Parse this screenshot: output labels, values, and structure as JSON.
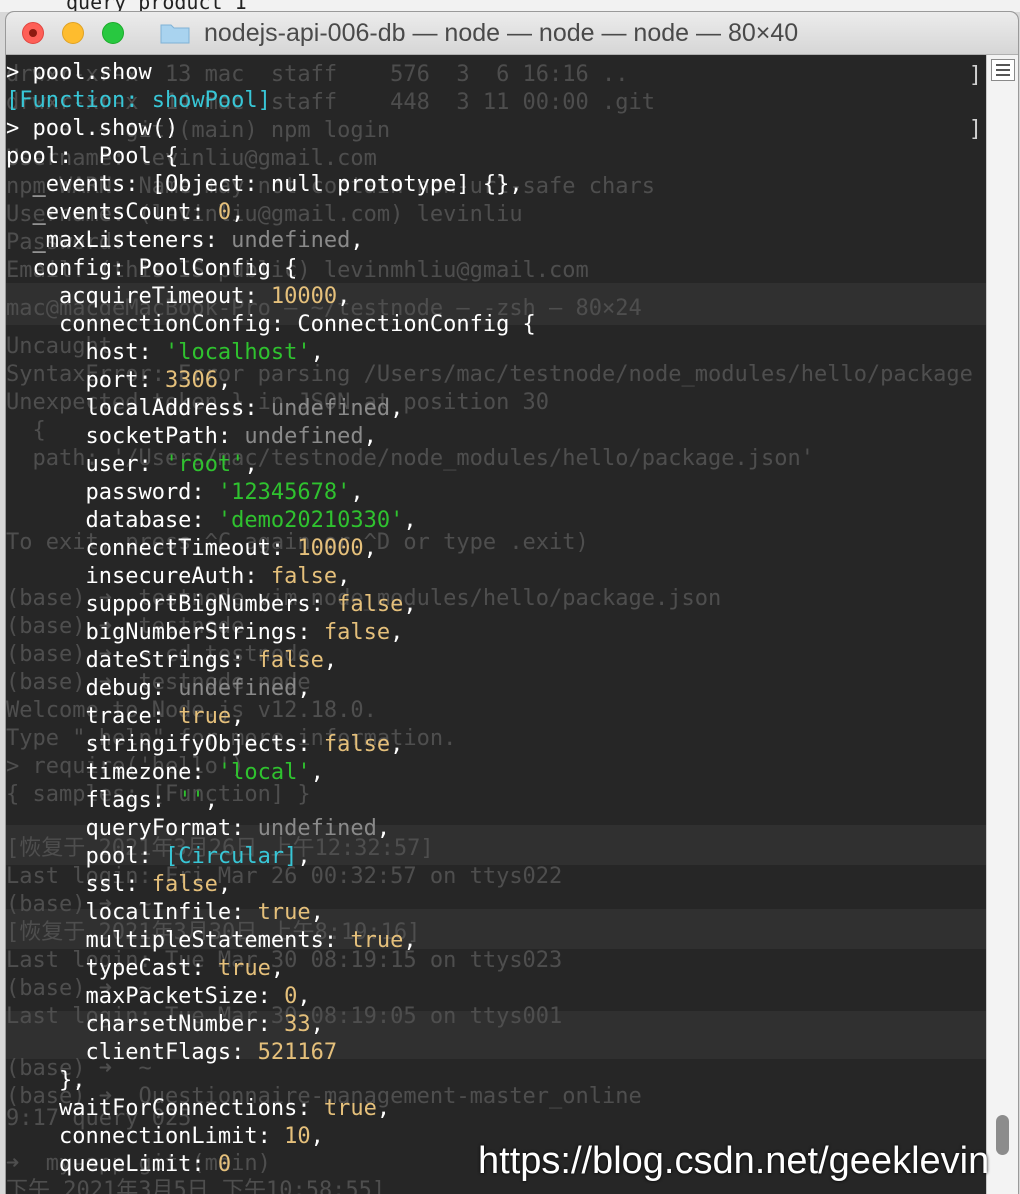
{
  "window": {
    "title": "nodejs-api-006-db — node — node — node — 80×40"
  },
  "top_bleed_text": "query product 1",
  "background_text": [
    "drwxr-xr-x  13 mac  staff    576  3  6 16:16 ..",
    "drwxr-xr-x  14 mac  staff    448  3 11 00:00 .git",
    "    ➜  ~ git:(main) npm login",
    "Username: levinliu@gmail.com",
    "npm WARN  Name may not contain non-url-safe chars",
    "Username: (levinliu@gmail.com) levinliu",
    "Password:",
    "Email: (this IS public) levinmhliu@gmail.com",
    "mac@macdeMacBook-Pro — ~/testnode — -zsh — 80×24",
    "Uncaught",
    "SyntaxError: Error parsing /Users/mac/testnode/node_modules/hello/package",
    "Unexpected token } in JSON at position 30",
    "  {",
    "  path: '/Users/mac/testnode/node_modules/hello/package.json'",
    "To exit, press ^C again or ^D or type .exit)",
    "(base) ➜  testnode vim node_modules/hello/package.json",
    "(base) ➜  testnode",
    "(base) ➜  ~ cd testnode",
    "(base) ➜  testnode node",
    "Welcome to Node.js v12.18.0.",
    "Type \".help\" for more information.",
    "> require('hello')",
    "{ samples: [Function] }",
    "[恢复于 2021年3月26日 上午12:32:57]",
    "Last login: Fri Mar 26 00:32:57 on ttys022",
    "(base) ➜  ~",
    "[恢复于 2021年3月30日 上午8:19:16]",
    "Last login: Tue Mar 30 08:19:15 on ttys023",
    "(base) ➜  ~",
    "Last login: Tue Mar 30 08:19:05 on ttys001",
    "(base) ➜  ~",
    "(base) ➜  Questionnaire-management-master_online",
    "9:17 query 025",
    "➜  my-app git:(main)",
    "下午 2021年3月5日 下午10:58:55]"
  ],
  "console": {
    "lines": [
      [
        {
          "t": "> pool.show",
          "c": "w"
        }
      ],
      [
        {
          "t": "[Function: showPool]",
          "c": "spec"
        }
      ],
      [
        {
          "t": "> pool.show()",
          "c": "w"
        }
      ],
      [
        {
          "t": "pool:  Pool {",
          "c": "w"
        }
      ],
      [
        {
          "t": "  _events: [Object: null prototype] {},",
          "c": "w"
        }
      ],
      [
        {
          "t": "  _eventsCount: ",
          "c": "w"
        },
        {
          "t": "0",
          "c": "num"
        },
        {
          "t": ",",
          "c": "w"
        }
      ],
      [
        {
          "t": "  _maxListeners: ",
          "c": "w"
        },
        {
          "t": "undefined",
          "c": "undef"
        },
        {
          "t": ",",
          "c": "w"
        }
      ],
      [
        {
          "t": "  config: PoolConfig {",
          "c": "w"
        }
      ],
      [
        {
          "t": "    acquireTimeout: ",
          "c": "w"
        },
        {
          "t": "10000",
          "c": "num"
        },
        {
          "t": ",",
          "c": "w"
        }
      ],
      [
        {
          "t": "    connectionConfig: ConnectionConfig {",
          "c": "w"
        }
      ],
      [
        {
          "t": "      host: ",
          "c": "w"
        },
        {
          "t": "'localhost'",
          "c": "str"
        },
        {
          "t": ",",
          "c": "w"
        }
      ],
      [
        {
          "t": "      port: ",
          "c": "w"
        },
        {
          "t": "3306",
          "c": "num"
        },
        {
          "t": ",",
          "c": "w"
        }
      ],
      [
        {
          "t": "      localAddress: ",
          "c": "w"
        },
        {
          "t": "undefined",
          "c": "undef"
        },
        {
          "t": ",",
          "c": "w"
        }
      ],
      [
        {
          "t": "      socketPath: ",
          "c": "w"
        },
        {
          "t": "undefined",
          "c": "undef"
        },
        {
          "t": ",",
          "c": "w"
        }
      ],
      [
        {
          "t": "      user: ",
          "c": "w"
        },
        {
          "t": "'root'",
          "c": "str"
        },
        {
          "t": ",",
          "c": "w"
        }
      ],
      [
        {
          "t": "      password: ",
          "c": "w"
        },
        {
          "t": "'12345678'",
          "c": "str"
        },
        {
          "t": ",",
          "c": "w"
        }
      ],
      [
        {
          "t": "      database: ",
          "c": "w"
        },
        {
          "t": "'demo20210330'",
          "c": "str"
        },
        {
          "t": ",",
          "c": "w"
        }
      ],
      [
        {
          "t": "      connectTimeout: ",
          "c": "w"
        },
        {
          "t": "10000",
          "c": "num"
        },
        {
          "t": ",",
          "c": "w"
        }
      ],
      [
        {
          "t": "      insecureAuth: ",
          "c": "w"
        },
        {
          "t": "false",
          "c": "bool"
        },
        {
          "t": ",",
          "c": "w"
        }
      ],
      [
        {
          "t": "      supportBigNumbers: ",
          "c": "w"
        },
        {
          "t": "false",
          "c": "bool"
        },
        {
          "t": ",",
          "c": "w"
        }
      ],
      [
        {
          "t": "      bigNumberStrings: ",
          "c": "w"
        },
        {
          "t": "false",
          "c": "bool"
        },
        {
          "t": ",",
          "c": "w"
        }
      ],
      [
        {
          "t": "      dateStrings: ",
          "c": "w"
        },
        {
          "t": "false",
          "c": "bool"
        },
        {
          "t": ",",
          "c": "w"
        }
      ],
      [
        {
          "t": "      debug: ",
          "c": "w"
        },
        {
          "t": "undefined",
          "c": "undef"
        },
        {
          "t": ",",
          "c": "w"
        }
      ],
      [
        {
          "t": "      trace: ",
          "c": "w"
        },
        {
          "t": "true",
          "c": "bool"
        },
        {
          "t": ",",
          "c": "w"
        }
      ],
      [
        {
          "t": "      stringifyObjects: ",
          "c": "w"
        },
        {
          "t": "false",
          "c": "bool"
        },
        {
          "t": ",",
          "c": "w"
        }
      ],
      [
        {
          "t": "      timezone: ",
          "c": "w"
        },
        {
          "t": "'local'",
          "c": "str"
        },
        {
          "t": ",",
          "c": "w"
        }
      ],
      [
        {
          "t": "      flags: ",
          "c": "w"
        },
        {
          "t": "''",
          "c": "str"
        },
        {
          "t": ",",
          "c": "w"
        }
      ],
      [
        {
          "t": "      queryFormat: ",
          "c": "w"
        },
        {
          "t": "undefined",
          "c": "undef"
        },
        {
          "t": ",",
          "c": "w"
        }
      ],
      [
        {
          "t": "      pool: ",
          "c": "w"
        },
        {
          "t": "[Circular]",
          "c": "spec"
        },
        {
          "t": ",",
          "c": "w"
        }
      ],
      [
        {
          "t": "      ssl: ",
          "c": "w"
        },
        {
          "t": "false",
          "c": "bool"
        },
        {
          "t": ",",
          "c": "w"
        }
      ],
      [
        {
          "t": "      localInfile: ",
          "c": "w"
        },
        {
          "t": "true",
          "c": "bool"
        },
        {
          "t": ",",
          "c": "w"
        }
      ],
      [
        {
          "t": "      multipleStatements: ",
          "c": "w"
        },
        {
          "t": "true",
          "c": "bool"
        },
        {
          "t": ",",
          "c": "w"
        }
      ],
      [
        {
          "t": "      typeCast: ",
          "c": "w"
        },
        {
          "t": "true",
          "c": "bool"
        },
        {
          "t": ",",
          "c": "w"
        }
      ],
      [
        {
          "t": "      maxPacketSize: ",
          "c": "w"
        },
        {
          "t": "0",
          "c": "num"
        },
        {
          "t": ",",
          "c": "w"
        }
      ],
      [
        {
          "t": "      charsetNumber: ",
          "c": "w"
        },
        {
          "t": "33",
          "c": "num"
        },
        {
          "t": ",",
          "c": "w"
        }
      ],
      [
        {
          "t": "      clientFlags: ",
          "c": "w"
        },
        {
          "t": "521167",
          "c": "num"
        }
      ],
      [
        {
          "t": "    },",
          "c": "w"
        }
      ],
      [
        {
          "t": "    waitForConnections: ",
          "c": "w"
        },
        {
          "t": "true",
          "c": "bool"
        },
        {
          "t": ",",
          "c": "w"
        }
      ],
      [
        {
          "t": "    connectionLimit: ",
          "c": "w"
        },
        {
          "t": "10",
          "c": "num"
        },
        {
          "t": ",",
          "c": "w"
        }
      ],
      [
        {
          "t": "    queueLimit: ",
          "c": "w"
        },
        {
          "t": "0",
          "c": "num"
        }
      ]
    ]
  },
  "watermark": "https://blog.csdn.net/geeklevin",
  "colors": {
    "number": "#e5c07b",
    "string": "#2fc22f",
    "undefined": "#8a8a8a",
    "special": "#38c6d6",
    "text": "#ffffff",
    "background": "#262626"
  }
}
